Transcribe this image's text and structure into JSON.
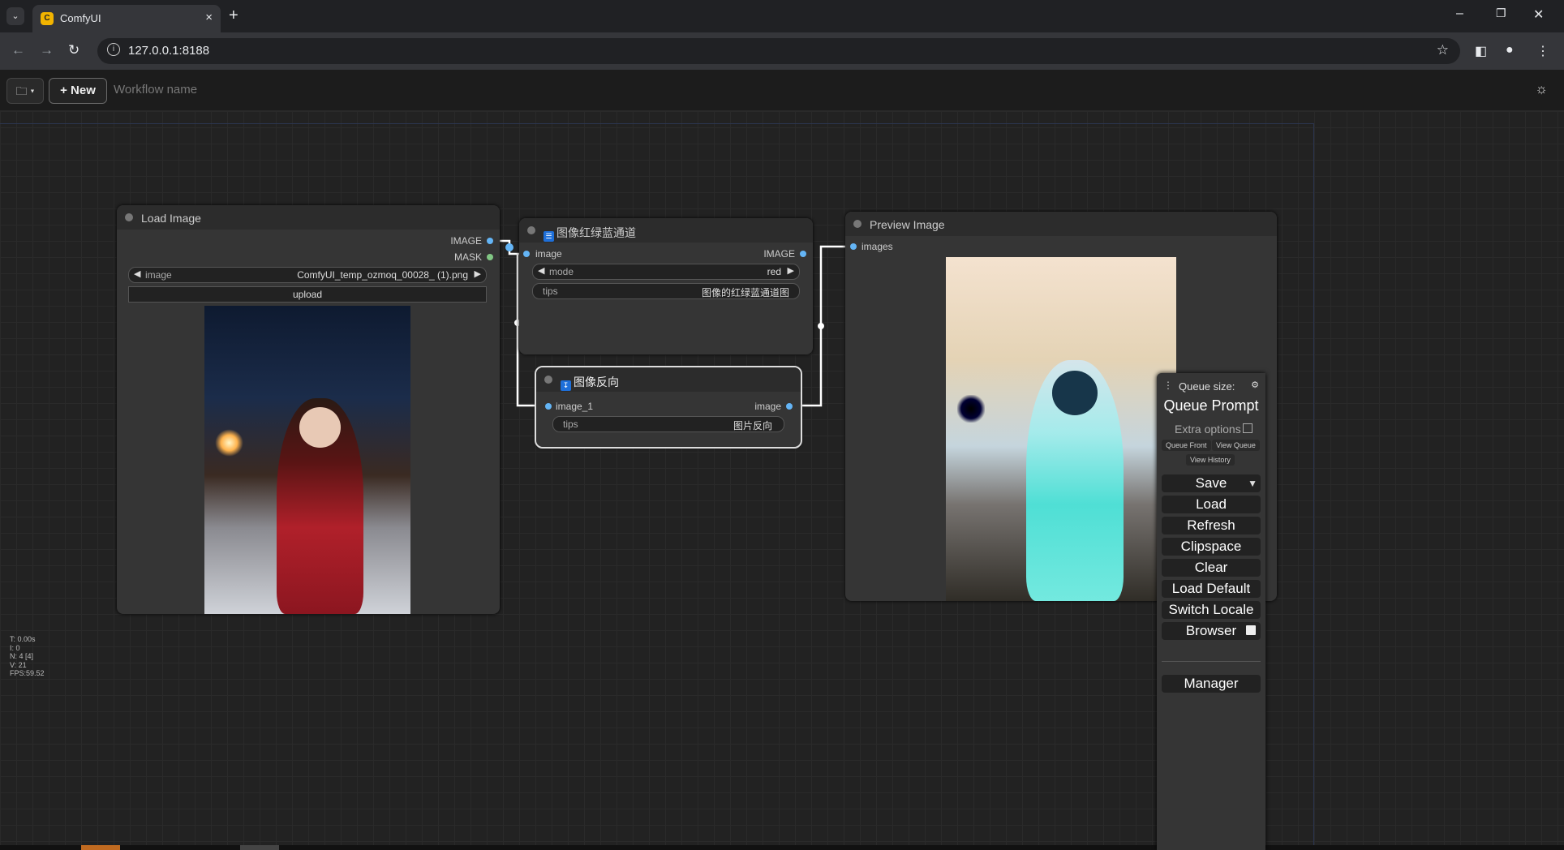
{
  "browser": {
    "tab_title": "ComfyUI",
    "tab_favicon": "C",
    "tab_close": "×",
    "new_tab": "+",
    "tab_list": "⌄",
    "url": "127.0.0.1:8188",
    "win_minimize": "–",
    "win_restore": "❐",
    "win_close": "✕"
  },
  "appbar": {
    "workflow_menu_label": "▾",
    "new_button_label": "+ New",
    "workflow_name_placeholder": "Workflow name",
    "theme_icon": "☼"
  },
  "nodes": {
    "load_image": {
      "title": "Load Image",
      "outputs": [
        "IMAGE",
        "MASK"
      ],
      "image_widget_label": "image",
      "image_widget_value": "ComfyUI_temp_ozmoq_00028_ (1).png",
      "upload_label": "upload"
    },
    "rgb_channel": {
      "title": "图像红绿蓝通道",
      "input": "image",
      "output": "IMAGE",
      "mode_label": "mode",
      "mode_value": "red",
      "tips_label": "tips",
      "tips_value": "图像的红绿蓝通道图"
    },
    "invert": {
      "title": "图像反向",
      "input": "image_1",
      "output": "image",
      "tips_label": "tips",
      "tips_value": "图片反向"
    },
    "preview": {
      "title": "Preview Image",
      "input": "images"
    }
  },
  "stats": {
    "t": "T: 0.00s",
    "i": "I: 0",
    "n": "N: 4 [4]",
    "v": "V: 21",
    "fps": "FPS:59.52"
  },
  "menu": {
    "queue_size": "Queue size: ",
    "queue_prompt": "Queue Prompt",
    "extra_options": "Extra options",
    "queue_front": "Queue Front",
    "view_queue": "View Queue",
    "view_history": "View History",
    "save": "Save",
    "load": "Load",
    "refresh": "Refresh",
    "clipspace": "Clipspace",
    "clear": "Clear",
    "load_default": "Load Default",
    "switch_locale": "Switch Locale",
    "browser": "Browser",
    "manager": "Manager"
  },
  "colors": {
    "image_slot": "#64b5f6",
    "mask_slot": "#81c784",
    "link": "#ffffff"
  }
}
